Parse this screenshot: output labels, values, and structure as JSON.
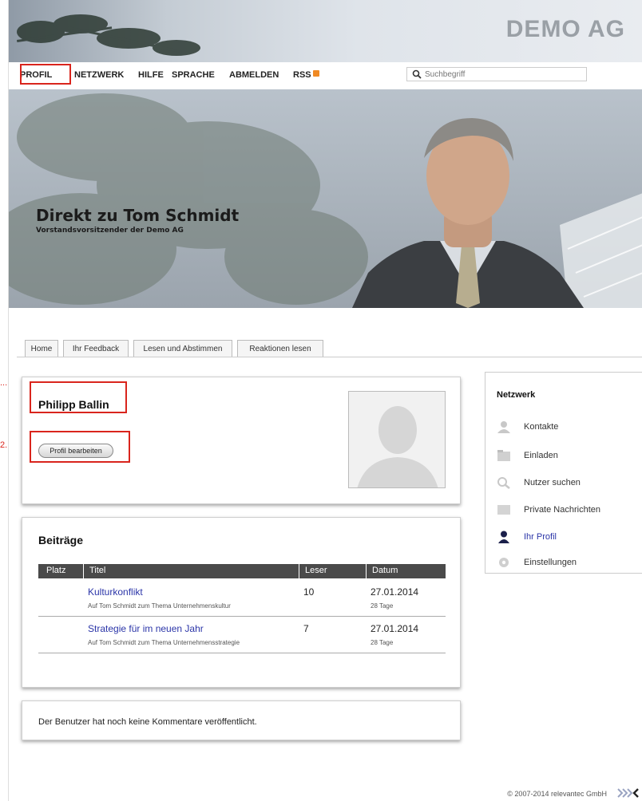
{
  "header": {
    "brand": "DEMO AG",
    "nav": [
      "PROFIL",
      "NETZWERK",
      "HILFE",
      "SPRACHE",
      "ABMELDEN",
      "RSS"
    ],
    "search_placeholder": "Suchbegriff"
  },
  "banner": {
    "title": "Direkt zu Tom Schmidt",
    "subtitle": "Vorstandsvorsitzender der Demo AG"
  },
  "tabs": [
    "Home",
    "Ihr Feedback",
    "Lesen und Abstimmen",
    "Reaktionen lesen"
  ],
  "profile": {
    "name": "Philipp Ballin",
    "edit_label": "Profil bearbeiten"
  },
  "beitraege": {
    "title": "Beiträge",
    "columns": [
      "Platz",
      "Titel",
      "Leser",
      "Datum"
    ],
    "rows": [
      {
        "title": "Kulturkonflikt",
        "desc": "Auf Tom Schmidt zum Thema Unternehmenskultur",
        "leser": "10",
        "datum": "27.01.2014",
        "age": "28 Tage"
      },
      {
        "title": "Strategie für im neuen Jahr",
        "desc": "Auf Tom Schmidt zum Thema Unternehmensstrategie",
        "leser": "7",
        "datum": "27.01.2014",
        "age": "28 Tage"
      }
    ]
  },
  "comments": {
    "empty_text": "Der Benutzer hat noch keine Kommentare veröffentlicht."
  },
  "sidebar": {
    "title": "Netzwerk",
    "items": [
      {
        "label": "Kontakte",
        "icon": "contacts-icon"
      },
      {
        "label": "Einladen",
        "icon": "invite-icon"
      },
      {
        "label": "Nutzer suchen",
        "icon": "search-user-icon"
      },
      {
        "label": "Private Nachrichten",
        "icon": "messages-icon"
      },
      {
        "label": "Ihr Profil",
        "icon": "profile-icon"
      },
      {
        "label": "Einstellungen",
        "icon": "settings-icon"
      }
    ]
  },
  "markers": [
    "...",
    "2."
  ],
  "footer": {
    "copyright": "© 2007-2014 relevantec GmbH"
  },
  "colors": {
    "highlight": "#d9251d",
    "link": "#2b35a8",
    "table_header": "#4a4a4a"
  }
}
